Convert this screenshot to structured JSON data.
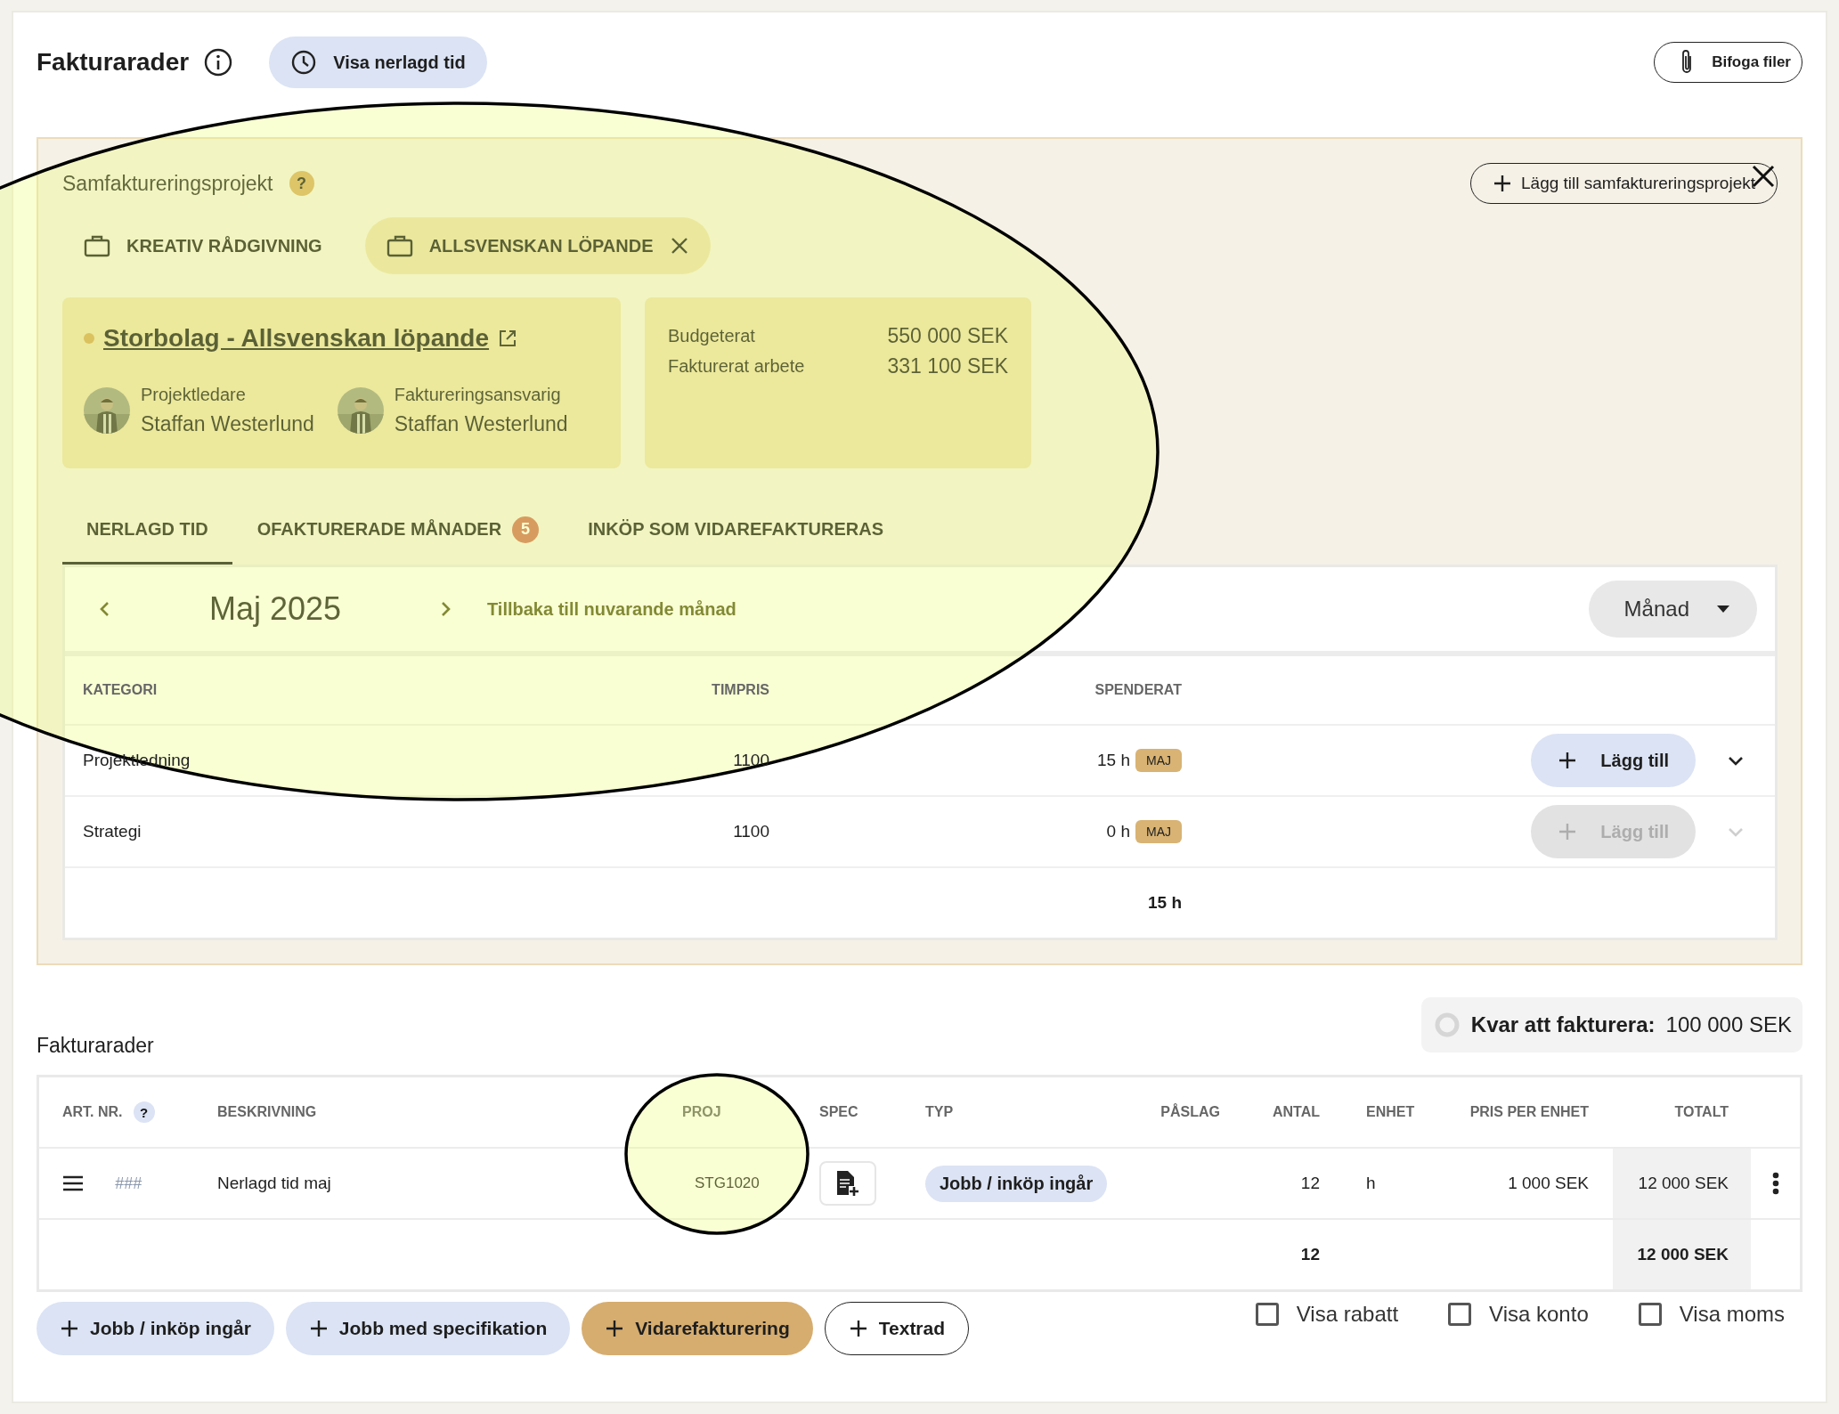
{
  "header": {
    "title": "Fakturarader",
    "show_time_button": "Visa nerlagd tid",
    "attach_button": "Bifoga filer"
  },
  "co_billing": {
    "label": "Samfaktureringsprojekt",
    "help": "?",
    "add_button": "Lägg till samfaktureringsprojekt",
    "projects": [
      {
        "name": "KREATIV RÅDGIVNING",
        "selected": false
      },
      {
        "name": "ALLSVENSKAN LÖPANDE",
        "selected": true
      }
    ],
    "project_card": {
      "title": "Storbolag - Allsvenskan löpande",
      "people": [
        {
          "role": "Projektledare",
          "name": "Staffan Westerlund"
        },
        {
          "role": "Faktureringsansvarig",
          "name": "Staffan Westerlund"
        }
      ]
    },
    "budget": [
      {
        "label": "Budgeterat",
        "value": "550 000 SEK"
      },
      {
        "label": "Fakturerat arbete",
        "value": "331 100 SEK"
      }
    ],
    "tabs": [
      {
        "label": "NERLAGD TID",
        "selected": true
      },
      {
        "label": "OFAKTURERADE MÅNADER",
        "selected": false,
        "badge": "5"
      },
      {
        "label": "INKÖP SOM VIDAREFAKTURERAS",
        "selected": false
      }
    ],
    "month": {
      "label": "Maj 2025",
      "back_link": "Tillbaka till nuvarande månad",
      "period": "Månad"
    },
    "time_table": {
      "columns": [
        "KATEGORI",
        "TIMPRIS",
        "SPENDERAT"
      ],
      "rows": [
        {
          "category": "Projektledning",
          "rate": "1100",
          "hours": "15 h",
          "month_tag": "MAJ",
          "add_button": "Lägg till",
          "disabled": false
        },
        {
          "category": "Strategi",
          "rate": "1100",
          "hours": "0 h",
          "month_tag": "MAJ",
          "add_button": "Lägg till",
          "disabled": true
        }
      ],
      "total": "15 h"
    }
  },
  "invoice_rows": {
    "title": "Fakturarader",
    "remaining_label": "Kvar att fakturera:",
    "remaining_value": "100 000 SEK",
    "help": "?",
    "columns": [
      "ART. NR.",
      "BESKRIVNING",
      "PROJ",
      "SPEC",
      "TYP",
      "PÅSLAG",
      "ANTAL",
      "ENHET",
      "PRIS PER ENHET",
      "TOTALT"
    ],
    "rows": [
      {
        "art_placeholder": "###",
        "description": "Nerlagd tid maj",
        "project": "STG1020",
        "type": "Jobb / inköp ingår",
        "quantity": "12",
        "unit": "h",
        "unit_price": "1 000 SEK",
        "total": "12 000 SEK"
      }
    ],
    "totals": {
      "quantity": "12",
      "total": "12 000 SEK"
    }
  },
  "add_buttons": [
    {
      "label": "Jobb / inköp ingår",
      "kind": "soft"
    },
    {
      "label": "Jobb med specifikation",
      "kind": "soft"
    },
    {
      "label": "Vidarefakturering",
      "kind": "accent"
    },
    {
      "label": "Textrad",
      "kind": "outline"
    }
  ],
  "options": [
    {
      "label": "Visa rabatt",
      "checked": false
    },
    {
      "label": "Visa konto",
      "checked": false
    },
    {
      "label": "Visa moms",
      "checked": false
    }
  ],
  "annotations": [
    {
      "kind": "ellipse"
    },
    {
      "kind": "circle"
    },
    {
      "kind": "cross"
    }
  ]
}
